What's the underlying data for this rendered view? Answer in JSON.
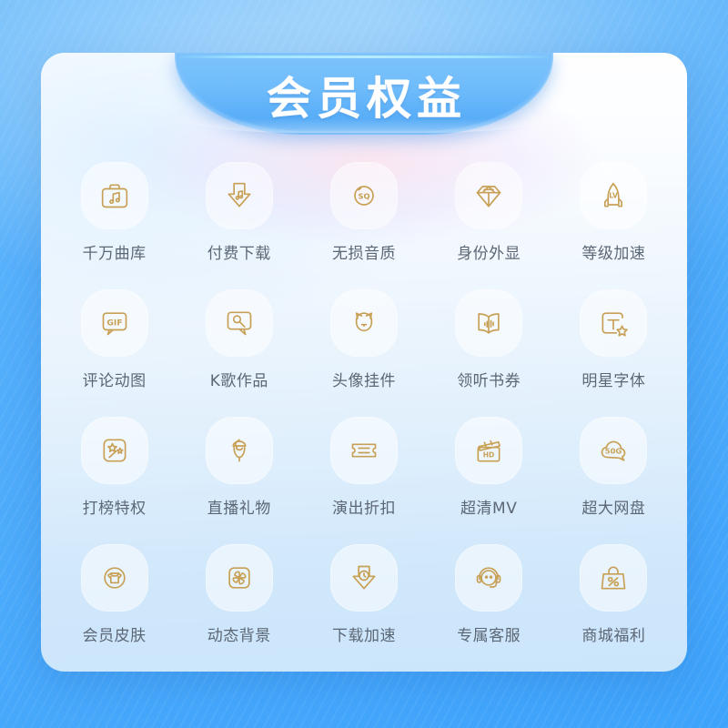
{
  "banner": {
    "title": "会员权益"
  },
  "theme": {
    "background_blue": "#4fa9fb",
    "card_top": "#ffffff",
    "card_bottom": "#cbe5fb",
    "banner_blue": "#6fbcfb",
    "icon_gold": "#c8a055",
    "label_gray": "#5c6775",
    "tile_fill": "rgba(255,255,255,0.52)"
  },
  "benefits": [
    {
      "label": "千万曲库",
      "icon": "music-briefcase-icon"
    },
    {
      "label": "付费下载",
      "icon": "download-note-icon"
    },
    {
      "label": "无损音质",
      "icon": "sq-circle-icon"
    },
    {
      "label": "身份外显",
      "icon": "diamond-icon"
    },
    {
      "label": "等级加速",
      "icon": "lv-rocket-icon"
    },
    {
      "label": "评论动图",
      "icon": "gif-bubble-icon"
    },
    {
      "label": "K歌作品",
      "icon": "microphone-bubble-icon"
    },
    {
      "label": "头像挂件",
      "icon": "cat-face-icon"
    },
    {
      "label": "领听书券",
      "icon": "audiobook-icon"
    },
    {
      "label": "明星字体",
      "icon": "text-star-icon"
    },
    {
      "label": "打榜特权",
      "icon": "magic-wand-icon"
    },
    {
      "label": "直播礼物",
      "icon": "rose-icon"
    },
    {
      "label": "演出折扣",
      "icon": "ticket-icon"
    },
    {
      "label": "超清MV",
      "icon": "hd-clapperboard-icon"
    },
    {
      "label": "超大网盘",
      "icon": "cloud-50g-icon"
    },
    {
      "label": "会员皮肤",
      "icon": "shirt-circle-icon"
    },
    {
      "label": "动态背景",
      "icon": "pinwheel-icon"
    },
    {
      "label": "下载加速",
      "icon": "download-clock-icon"
    },
    {
      "label": "专属客服",
      "icon": "headset-icon"
    },
    {
      "label": "商城福利",
      "icon": "percent-bag-icon"
    }
  ]
}
